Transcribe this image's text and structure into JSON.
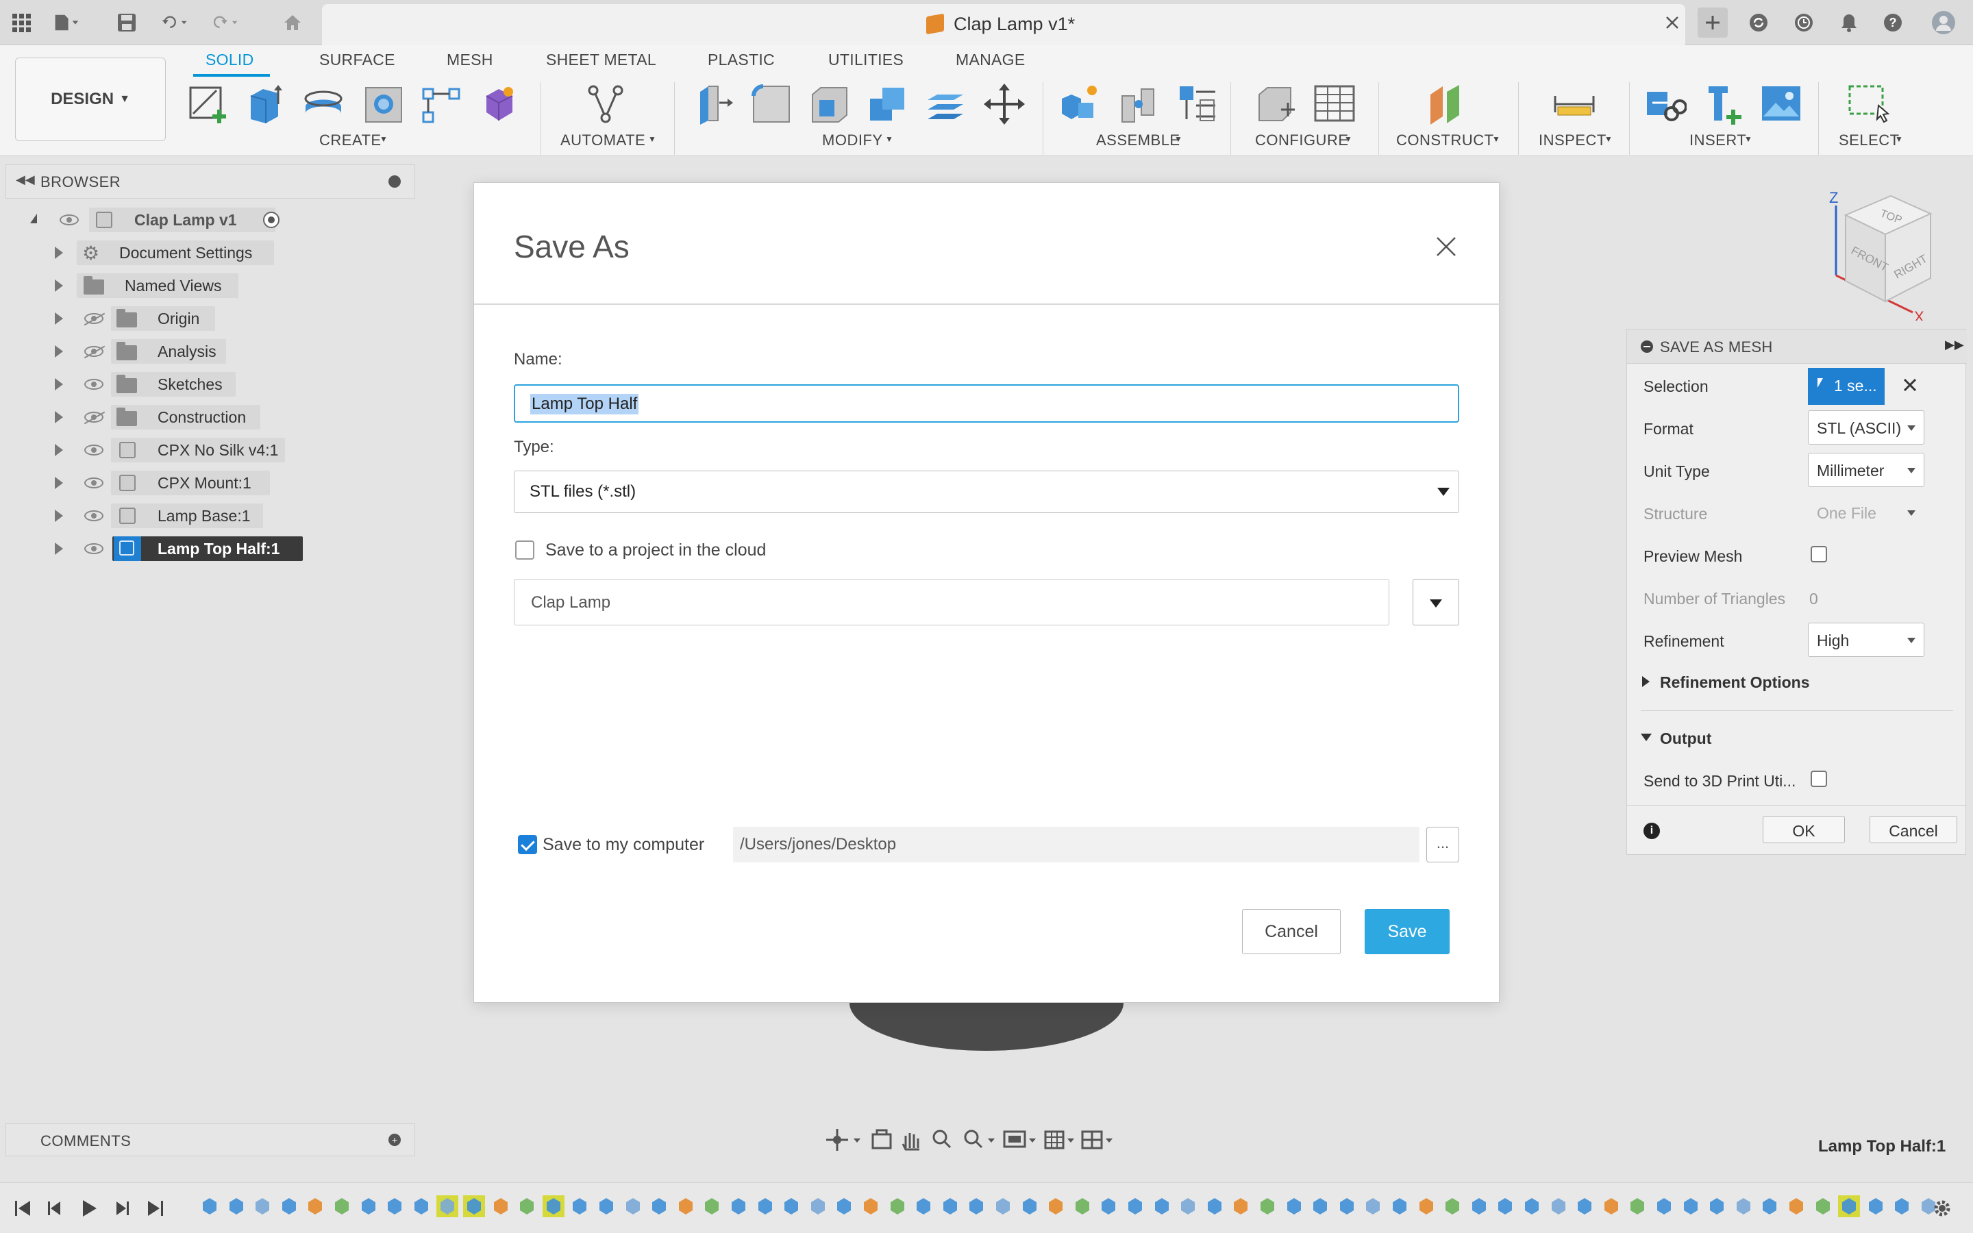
{
  "titlebar": {
    "document_title": "Clap Lamp v1*"
  },
  "ribbon": {
    "workspace_label": "DESIGN",
    "tabs": [
      "SOLID",
      "SURFACE",
      "MESH",
      "SHEET METAL",
      "PLASTIC",
      "UTILITIES",
      "MANAGE"
    ],
    "active_tab": "SOLID",
    "groups": [
      "CREATE",
      "AUTOMATE",
      "MODIFY",
      "ASSEMBLE",
      "CONFIGURE",
      "CONSTRUCT",
      "INSPECT",
      "INSERT",
      "SELECT"
    ]
  },
  "browser": {
    "title": "BROWSER",
    "root": "Clap Lamp v1",
    "items": [
      {
        "label": "Document Settings",
        "icon": "gear-icon"
      },
      {
        "label": "Named Views",
        "icon": "folder-icon"
      },
      {
        "label": "Origin",
        "icon": "folder-icon"
      },
      {
        "label": "Analysis",
        "icon": "folder-icon"
      },
      {
        "label": "Sketches",
        "icon": "folder-icon"
      },
      {
        "label": "Construction",
        "icon": "folder-icon"
      },
      {
        "label": "CPX No Silk v4:1",
        "icon": "component-icon"
      },
      {
        "label": "CPX Mount:1",
        "icon": "component-icon"
      },
      {
        "label": "Lamp Base:1",
        "icon": "component-icon"
      },
      {
        "label": "Lamp Top Half:1",
        "icon": "component-icon",
        "selected": true
      }
    ]
  },
  "comments": {
    "title": "COMMENTS"
  },
  "viewcube": {
    "top": "TOP",
    "front": "FRONT",
    "right": "RIGHT",
    "z": "Z",
    "x": "X"
  },
  "mesh_panel": {
    "title": "SAVE AS MESH",
    "selection_label": "Selection",
    "selection_value": "1 se...",
    "format_label": "Format",
    "format_value": "STL (ASCII)",
    "unit_label": "Unit Type",
    "unit_value": "Millimeter",
    "structure_label": "Structure",
    "structure_value": "One File",
    "preview_label": "Preview Mesh",
    "triangles_label": "Number of Triangles",
    "triangles_value": "0",
    "refinement_label": "Refinement",
    "refinement_value": "High",
    "refinement_options_label": "Refinement Options",
    "output_label": "Output",
    "send_label": "Send to 3D Print Uti...",
    "ok_label": "OK",
    "cancel_label": "Cancel"
  },
  "dialog": {
    "title": "Save As",
    "name_label": "Name:",
    "name_value": "Lamp Top Half",
    "type_label": "Type:",
    "type_value": "STL files (*.stl)",
    "cloud_label": "Save to a project in the cloud",
    "cloud_checked": false,
    "project_value": "Clap Lamp",
    "computer_label": "Save to my computer",
    "computer_checked": true,
    "path_value": "/Users/jones/Desktop",
    "browse_label": "...",
    "cancel_label": "Cancel",
    "save_label": "Save"
  },
  "status": {
    "selection": "Lamp Top Half:1"
  },
  "colors": {
    "accent": "#0696d7",
    "save_button": "#2ea8e1",
    "highlight": "#b3d4f7",
    "mesh_selection": "#1f7fd0"
  }
}
